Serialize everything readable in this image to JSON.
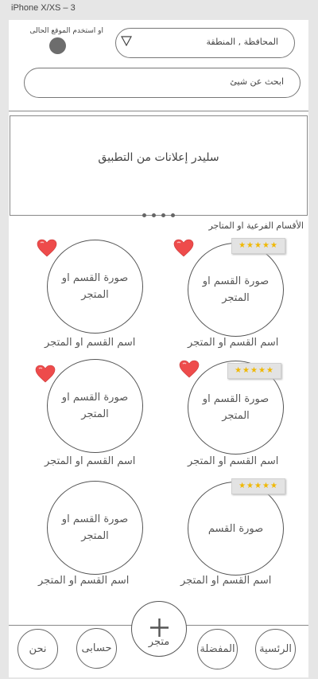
{
  "artboard": {
    "label": "iPhone X/XS – 3"
  },
  "header": {
    "location_hint": "او استخدم الموقع الحالى",
    "region_placeholder": "المحافظة , المنطقة",
    "search_placeholder": "ابحث عن شيئ"
  },
  "slider": {
    "text": "سليدر إعلانات من التطبيق",
    "dot_count": 4
  },
  "section": {
    "title": "الأقسام الفرعية او المتاجر"
  },
  "items": [
    {
      "image_label": "صورة القسم او المتجر",
      "name": "اسم القسم او المتجر",
      "rating": "★★★★★",
      "favorite": true
    },
    {
      "image_label": "صورة القسم او المتجر",
      "name": "اسم القسم او المتجر",
      "favorite": true
    },
    {
      "image_label": "صورة القسم او المتجر",
      "name": "اسم القسم او المتجر",
      "rating": "★★★★★",
      "favorite": true
    },
    {
      "image_label": "صورة القسم او المتجر",
      "name": "اسم القسم او المتجر",
      "favorite": true
    },
    {
      "image_label": "صورة القسم",
      "name": "اسم القسم او المتجر",
      "rating": "★★★★★",
      "favorite": false
    },
    {
      "image_label": "صورة القسم او المتجر",
      "name": "اسم القسم او المتجر",
      "favorite": false
    }
  ],
  "bottom_nav": {
    "home": "الرئسية",
    "favorites": "المفضلة",
    "store": "متجر",
    "account": "حسابى",
    "about": "نحن"
  },
  "colors": {
    "heart": "#ee4b4b",
    "star": "#f0b800",
    "dot": "#6d6d6d"
  }
}
